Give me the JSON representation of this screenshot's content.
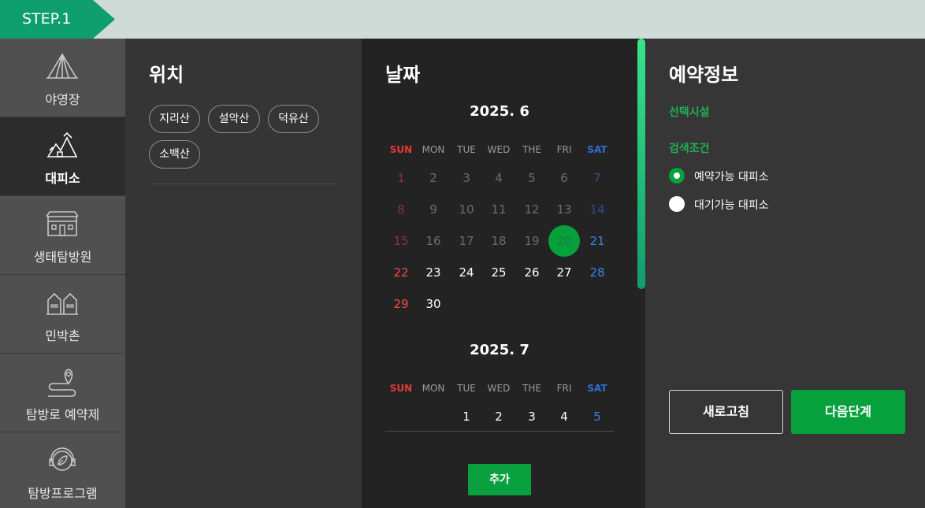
{
  "step": {
    "label": "STEP.1"
  },
  "sidebar": {
    "items": [
      {
        "label": "야영장",
        "icon": "tent-icon"
      },
      {
        "label": "대피소",
        "icon": "shelter-icon",
        "active": true
      },
      {
        "label": "생태탐방원",
        "icon": "building-icon"
      },
      {
        "label": "민박촌",
        "icon": "houses-icon"
      },
      {
        "label": "탐방로 예약제",
        "icon": "trail-pin-icon"
      },
      {
        "label": "탐방프로그램",
        "icon": "headset-leaf-icon"
      }
    ]
  },
  "location": {
    "title": "위치",
    "chips": [
      "지리산",
      "설악산",
      "덕유산",
      "소백산"
    ]
  },
  "date": {
    "title": "날짜",
    "weekdays": [
      "SUN",
      "MON",
      "TUE",
      "WED",
      "THE",
      "FRI",
      "SAT"
    ],
    "months": [
      {
        "title": "2025. 6",
        "weeks": [
          [
            "1",
            "2",
            "3",
            "4",
            "5",
            "6",
            "7"
          ],
          [
            "8",
            "9",
            "10",
            "11",
            "12",
            "13",
            "14"
          ],
          [
            "15",
            "16",
            "17",
            "18",
            "19",
            "20",
            "21"
          ],
          [
            "22",
            "23",
            "24",
            "25",
            "26",
            "27",
            "28"
          ],
          [
            "29",
            "30",
            "",
            "",
            "",
            "",
            ""
          ]
        ],
        "past_through": "19",
        "today": "20"
      },
      {
        "title": "2025. 7",
        "weeks": [
          [
            "",
            "",
            "1",
            "2",
            "3",
            "4",
            "5"
          ]
        ]
      }
    ],
    "add_label": "추가"
  },
  "reservation": {
    "title": "예약정보",
    "selected_facility_label": "선택시설",
    "search_condition_label": "검색조건",
    "options": [
      {
        "label": "예약가능 대피소",
        "checked": true
      },
      {
        "label": "대기가능 대피소",
        "checked": false
      }
    ],
    "refresh_label": "새로고침",
    "next_label": "다음단계"
  },
  "colors": {
    "accent_green": "#06a13d",
    "step_green": "#0f9e6e",
    "sunday_red": "#f04a4a",
    "saturday_blue": "#3d80ec"
  }
}
